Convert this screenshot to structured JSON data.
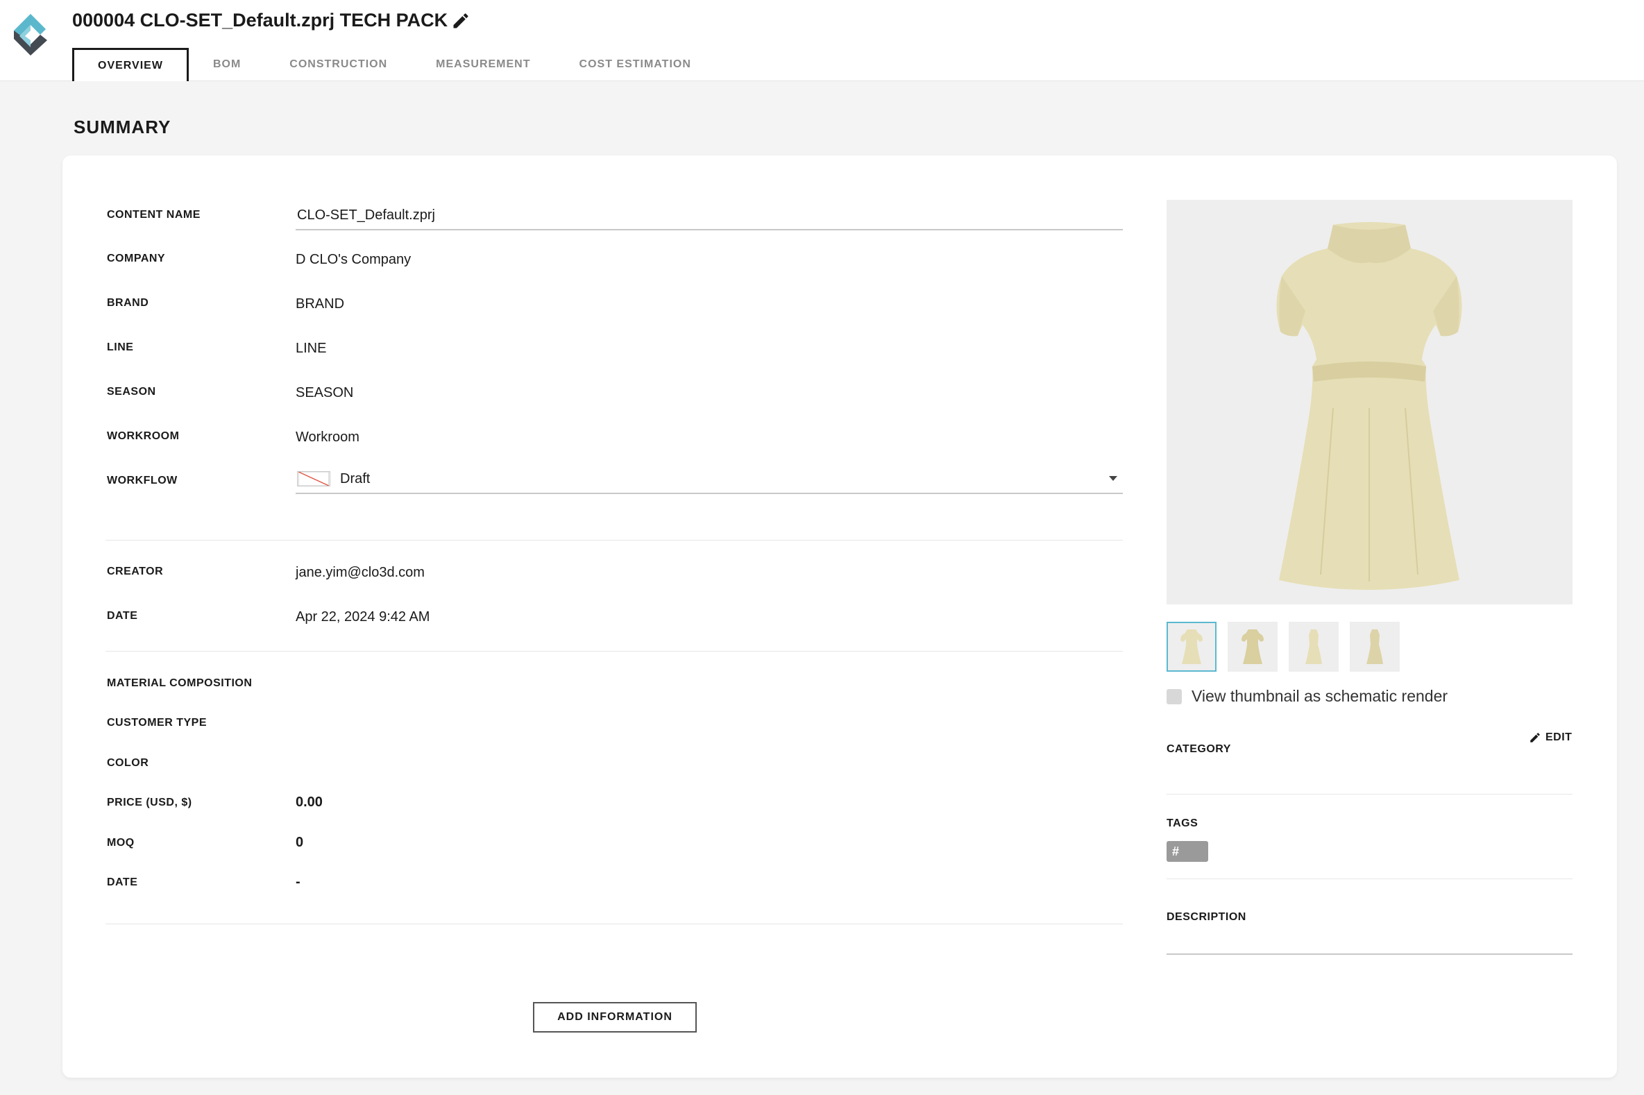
{
  "header": {
    "title": "000004 CLO-SET_Default.zprj TECH PACK",
    "tabs": [
      {
        "label": "OVERVIEW",
        "active": true
      },
      {
        "label": "BOM",
        "active": false
      },
      {
        "label": "CONSTRUCTION",
        "active": false
      },
      {
        "label": "MEASUREMENT",
        "active": false
      },
      {
        "label": "COST ESTIMATION",
        "active": false
      }
    ]
  },
  "summary": {
    "title": "SUMMARY",
    "fields": {
      "content_name": {
        "label": "CONTENT NAME",
        "value": "CLO-SET_Default.zprj"
      },
      "company": {
        "label": "COMPANY",
        "value": "D CLO's Company"
      },
      "brand": {
        "label": "BRAND",
        "value": "BRAND"
      },
      "line": {
        "label": "LINE",
        "value": "LINE"
      },
      "season": {
        "label": "SEASON",
        "value": "SEASON"
      },
      "workroom": {
        "label": "WORKROOM",
        "value": "Workroom"
      },
      "workflow": {
        "label": "WORKFLOW",
        "value": "Draft"
      },
      "creator": {
        "label": "CREATOR",
        "value": "jane.yim@clo3d.com"
      },
      "date": {
        "label": "DATE",
        "value": "Apr 22, 2024 9:42 AM"
      },
      "material_composition": {
        "label": "MATERIAL COMPOSITION",
        "value": ""
      },
      "customer_type": {
        "label": "CUSTOMER TYPE",
        "value": ""
      },
      "color": {
        "label": "COLOR",
        "value": ""
      },
      "price": {
        "label": "PRICE (USD, $)",
        "value": "0.00"
      },
      "moq": {
        "label": "MOQ",
        "value": "0"
      },
      "date2": {
        "label": "DATE",
        "value": "-"
      }
    },
    "add_button": "ADD INFORMATION"
  },
  "preview": {
    "schematic_checkbox_label": "View thumbnail as schematic render",
    "schematic_checked": false,
    "garment_color": "#e6deb6",
    "thumbnail_count": 4,
    "selected_thumbnail": 1
  },
  "meta": {
    "category_label": "CATEGORY",
    "edit_label": "EDIT",
    "tags_label": "TAGS",
    "tag_placeholder": "#",
    "description_label": "DESCRIPTION"
  },
  "colors": {
    "accent_selected": "#5ab9d0",
    "logo_teal": "#5bb8cc",
    "logo_dark": "#444a52"
  }
}
